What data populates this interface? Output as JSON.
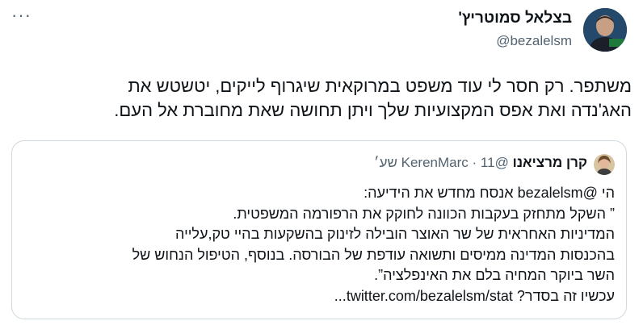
{
  "header": {
    "more_label": "···",
    "author_name": "בצלאל סמוטריץ'",
    "author_handle": "@bezalelsm"
  },
  "tweet": {
    "lines": [
      "משתפר. רק חסר לי עוד משפט במרוקאית שיגרוף לייקים, יטשטש את",
      "האג'נדה ואת אפס המקצועיות שלך ויתן תחושה שאת מחוברת אל העם."
    ]
  },
  "quote": {
    "author_name": "קרן מרציאנו",
    "author_handle": "@KerenMarc",
    "separator": "·",
    "time": "11 שע׳",
    "lines": [
      "הי @bezalelsm אנסח מחדש את הידיעה:",
      "” השקל מתחזק בעקבות הכוונה לחוקק את הרפורמה המשפטית.",
      "המדיניות האחראית של שר האוצר הובילה לזינוק בהשקעות בהיי טק,עלייה",
      "בהכנסות המדינה ממיסים ותשואה עודפת של הבורסה. בנוסף, הטיפול הנחוש של",
      "השר ביוקר המחיה בלם את האינפלציה”.",
      "עכשיו זה בסדר? twitter.com/bezalelsm/stat..."
    ]
  },
  "colors": {
    "text": "#0f1419",
    "secondary": "#536471",
    "border": "#cfd9de"
  }
}
